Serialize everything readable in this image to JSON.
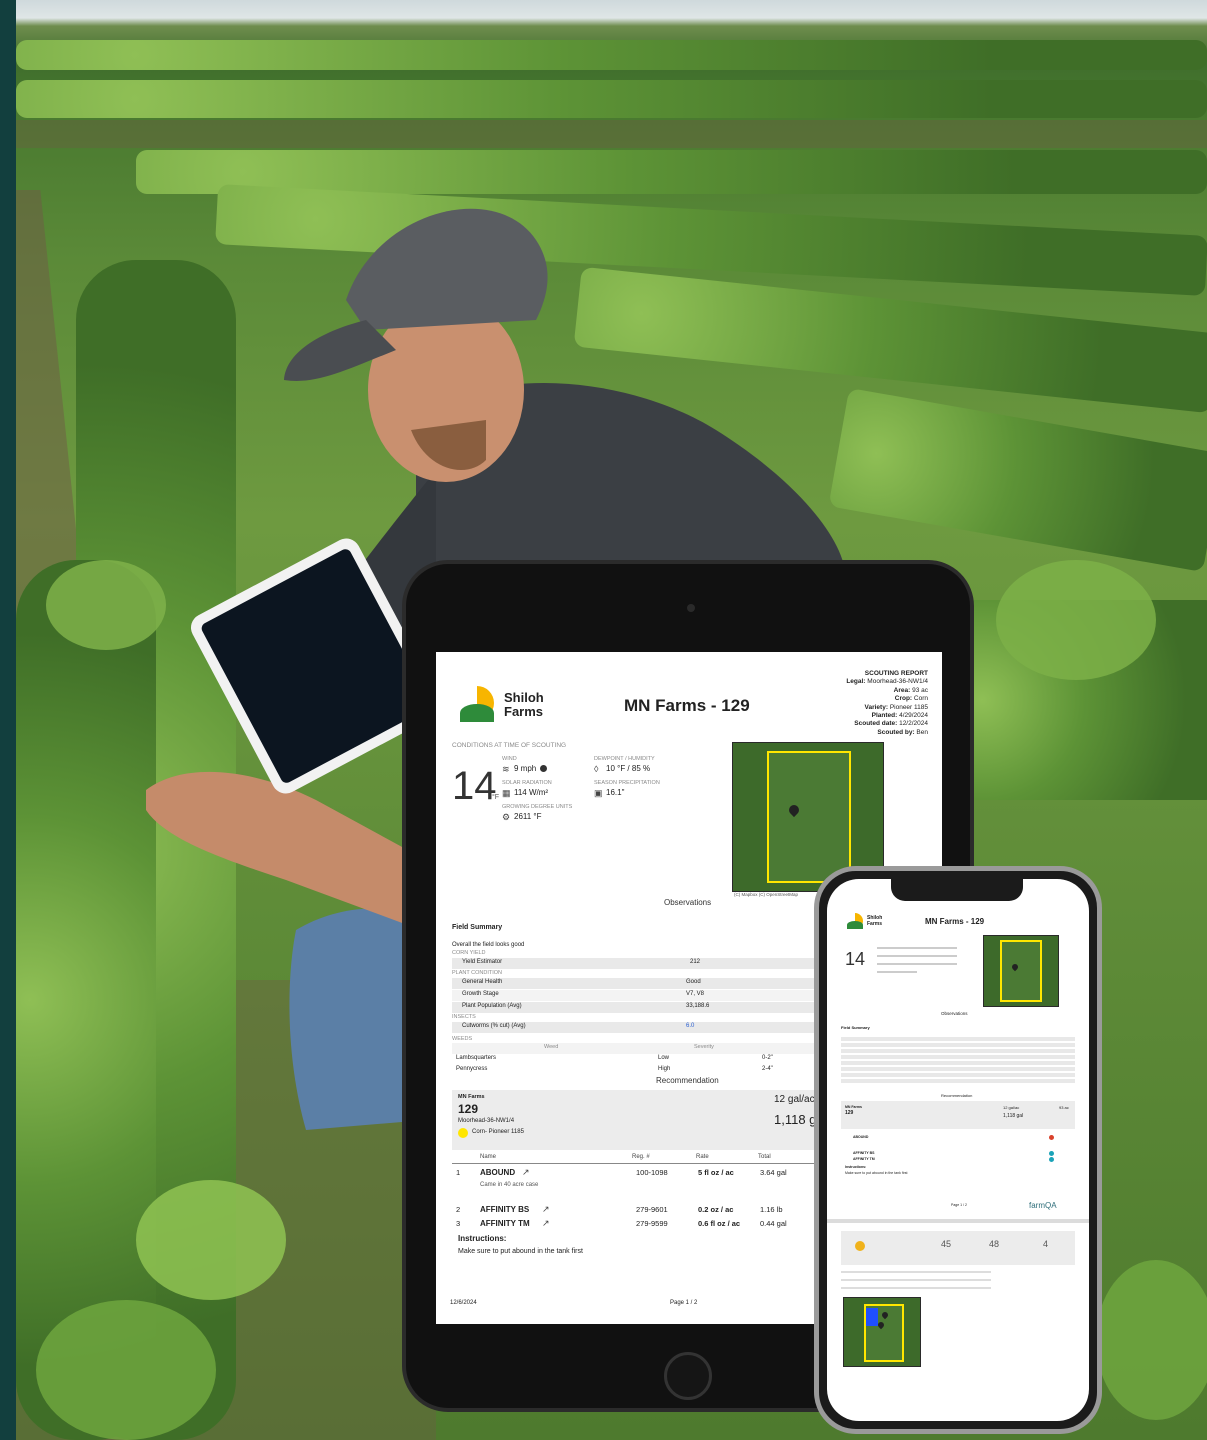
{
  "brand": {
    "name_line1": "Shiloh",
    "name_line2": "Farms"
  },
  "report": {
    "title": "MN Farms - 129",
    "kind": "SCOUTING REPORT",
    "legal_label": "Legal:",
    "legal": "Moorhead-36-NW1/4",
    "area_label": "Area:",
    "area": "93 ac",
    "crop_label": "Crop:",
    "crop": "Corn",
    "variety_label": "Variety:",
    "variety": "Pioneer 1185",
    "planted_label": "Planted:",
    "planted": "4/29/2024",
    "scouted_label": "Scouted date:",
    "scouted": "12/2/2024",
    "scouted_by_label": "Scouted by:",
    "scouted_by": "Ben"
  },
  "conditions": {
    "heading": "CONDITIONS AT TIME OF SCOUTING",
    "temp": "14",
    "temp_unit": "°F",
    "wind_label": "WIND",
    "wind": "9 mph",
    "solar_label": "SOLAR RADIATION",
    "solar": "114 W/m²",
    "gdu_label": "GROWING DEGREE UNITS",
    "gdu": "2611 °F",
    "dew_label": "DEWPOINT / HUMIDITY",
    "dew": "10 °F / 85 %",
    "precip_label": "SEASON PRECIPITATION",
    "precip": "16.1\""
  },
  "map_credit": "(C) Mapbox (C) OpenStreetMap",
  "observations": {
    "heading": "Observations",
    "summary_title": "Field Summary",
    "summary_text": "Overall the field looks good",
    "corn_yield_label": "CORN YIELD",
    "yield_estimator_label": "Yield Estimator",
    "yield_estimator": "212",
    "plant_condition_label": "PLANT CONDITION",
    "general_health_label": "General Health",
    "general_health": "Good",
    "growth_stage_label": "Growth Stage",
    "growth_stage": "V7, V8",
    "plant_pop_label": "Plant Population (Avg)",
    "plant_pop": "33,188.6",
    "insects_label": "INSECTS",
    "cutworms_label": "Cutworms (% cut) (Avg)",
    "cutworms": "6.0",
    "weeds_label": "WEEDS",
    "weed_col": "Weed",
    "severity_col": "Severity",
    "weeds": [
      {
        "name": "Lambsquarters",
        "severity": "Low",
        "size": "0-2\""
      },
      {
        "name": "Pennycress",
        "severity": "High",
        "size": "2-4\""
      }
    ]
  },
  "recommendation": {
    "heading": "Recommendation",
    "farm": "MN Farms",
    "field": "129",
    "legal": "Moorhead-36-NW1/4",
    "crop": "Corn- Pioneer 1185",
    "rate": "12 gal/ac",
    "total": "1,118 g",
    "columns": {
      "name": "Name",
      "reg": "Reg. #",
      "rate": "Rate",
      "total": "Total"
    },
    "products": [
      {
        "n": "1",
        "name": "ABOUND",
        "reg": "100-1098",
        "rate": "5 fl oz / ac",
        "total": "3.64 gal",
        "note": "Came in 40 acre case"
      },
      {
        "n": "2",
        "name": "AFFINITY BS",
        "reg": "279-9601",
        "rate": "0.2 oz / ac",
        "total": "1.16 lb",
        "note": ""
      },
      {
        "n": "3",
        "name": "AFFINITY TM",
        "reg": "279-9599",
        "rate": "0.6 fl oz / ac",
        "total": "0.44 gal",
        "note": ""
      }
    ],
    "instructions_label": "Instructions:",
    "instructions": "Make sure to put abound in the tank first"
  },
  "footer": {
    "date": "12/6/2024",
    "page": "Page 1 / 2"
  },
  "phone": {
    "title": "MN Farms - 129",
    "temp": "14",
    "observations": "Observations",
    "field_summary": "Field Summary",
    "recommendation": "Recommendation",
    "rate": "12 gal/ac",
    "total": "1,118 gal",
    "area": "93 ac",
    "farm": "MN Farms",
    "field": "129",
    "p1": "ABOUND",
    "p2": "AFFINITY BS",
    "p3": "AFFINITY TM",
    "instructions_label": "Instructions:",
    "instructions": "Make sure to put abound in the tank first",
    "page": "Page 1 / 2",
    "footer_logo": "farmQA",
    "stats": [
      "45",
      "48",
      "4"
    ]
  },
  "colors": {
    "accent_yellow": "#ffe600",
    "brand_green": "#2e8b3a",
    "brand_orange": "#f7b500",
    "status_red": "#d9412b",
    "status_teal": "#1aa3b8",
    "tint": "#0f3a3a"
  }
}
